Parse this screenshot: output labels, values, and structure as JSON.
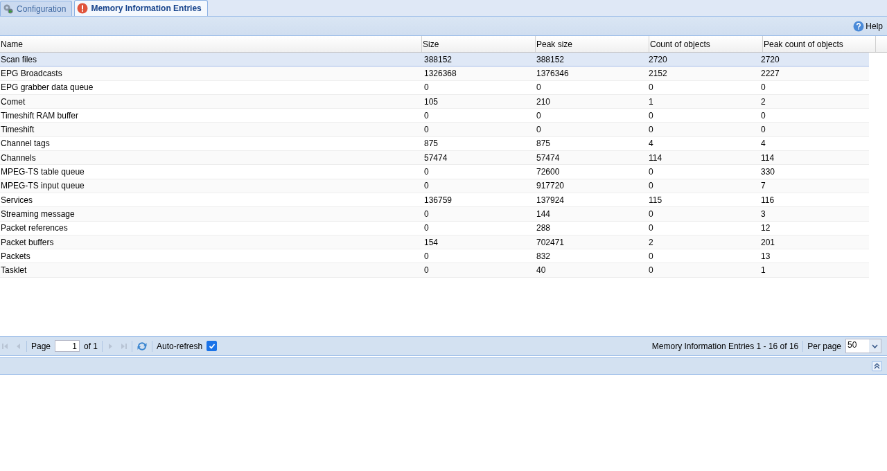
{
  "tabs": [
    {
      "label": "Configuration",
      "kind": "gears",
      "selected": false
    },
    {
      "label": "Memory Information Entries",
      "kind": "alert",
      "selected": true
    }
  ],
  "toolbar": {
    "help": "Help"
  },
  "table": {
    "columns": [
      "Name",
      "Size",
      "Peak size",
      "Count of objects",
      "Peak count of objects"
    ],
    "rows": [
      {
        "cells": [
          "Scan files",
          "388152",
          "388152",
          "2720",
          "2720"
        ],
        "selected": true
      },
      {
        "cells": [
          "EPG Broadcasts",
          "1326368",
          "1376346",
          "2152",
          "2227"
        ],
        "selected": false
      },
      {
        "cells": [
          "EPG grabber data queue",
          "0",
          "0",
          "0",
          "0"
        ],
        "selected": false
      },
      {
        "cells": [
          "Comet",
          "105",
          "210",
          "1",
          "2"
        ],
        "selected": false
      },
      {
        "cells": [
          "Timeshift RAM buffer",
          "0",
          "0",
          "0",
          "0"
        ],
        "selected": false
      },
      {
        "cells": [
          "Timeshift",
          "0",
          "0",
          "0",
          "0"
        ],
        "selected": false
      },
      {
        "cells": [
          "Channel tags",
          "875",
          "875",
          "4",
          "4"
        ],
        "selected": false
      },
      {
        "cells": [
          "Channels",
          "57474",
          "57474",
          "114",
          "114"
        ],
        "selected": false
      },
      {
        "cells": [
          "MPEG-TS table queue",
          "0",
          "72600",
          "0",
          "330"
        ],
        "selected": false
      },
      {
        "cells": [
          "MPEG-TS input queue",
          "0",
          "917720",
          "0",
          "7"
        ],
        "selected": false
      },
      {
        "cells": [
          "Services",
          "136759",
          "137924",
          "115",
          "116"
        ],
        "selected": false
      },
      {
        "cells": [
          "Streaming message",
          "0",
          "144",
          "0",
          "3"
        ],
        "selected": false
      },
      {
        "cells": [
          "Packet references",
          "0",
          "288",
          "0",
          "12"
        ],
        "selected": false
      },
      {
        "cells": [
          "Packet buffers",
          "154",
          "702471",
          "2",
          "201"
        ],
        "selected": false
      },
      {
        "cells": [
          "Packets",
          "0",
          "832",
          "0",
          "13"
        ],
        "selected": false
      },
      {
        "cells": [
          "Tasklet",
          "0",
          "40",
          "0",
          "1"
        ],
        "selected": false
      }
    ]
  },
  "paging": {
    "page_label": "Page",
    "page": "1",
    "of": "of 1",
    "auto_refresh": "Auto-refresh",
    "auto_refresh_checked": true,
    "summary": "Memory Information Entries 1 - 16 of 16",
    "per_page_label": "Per page",
    "per_page": "50"
  }
}
